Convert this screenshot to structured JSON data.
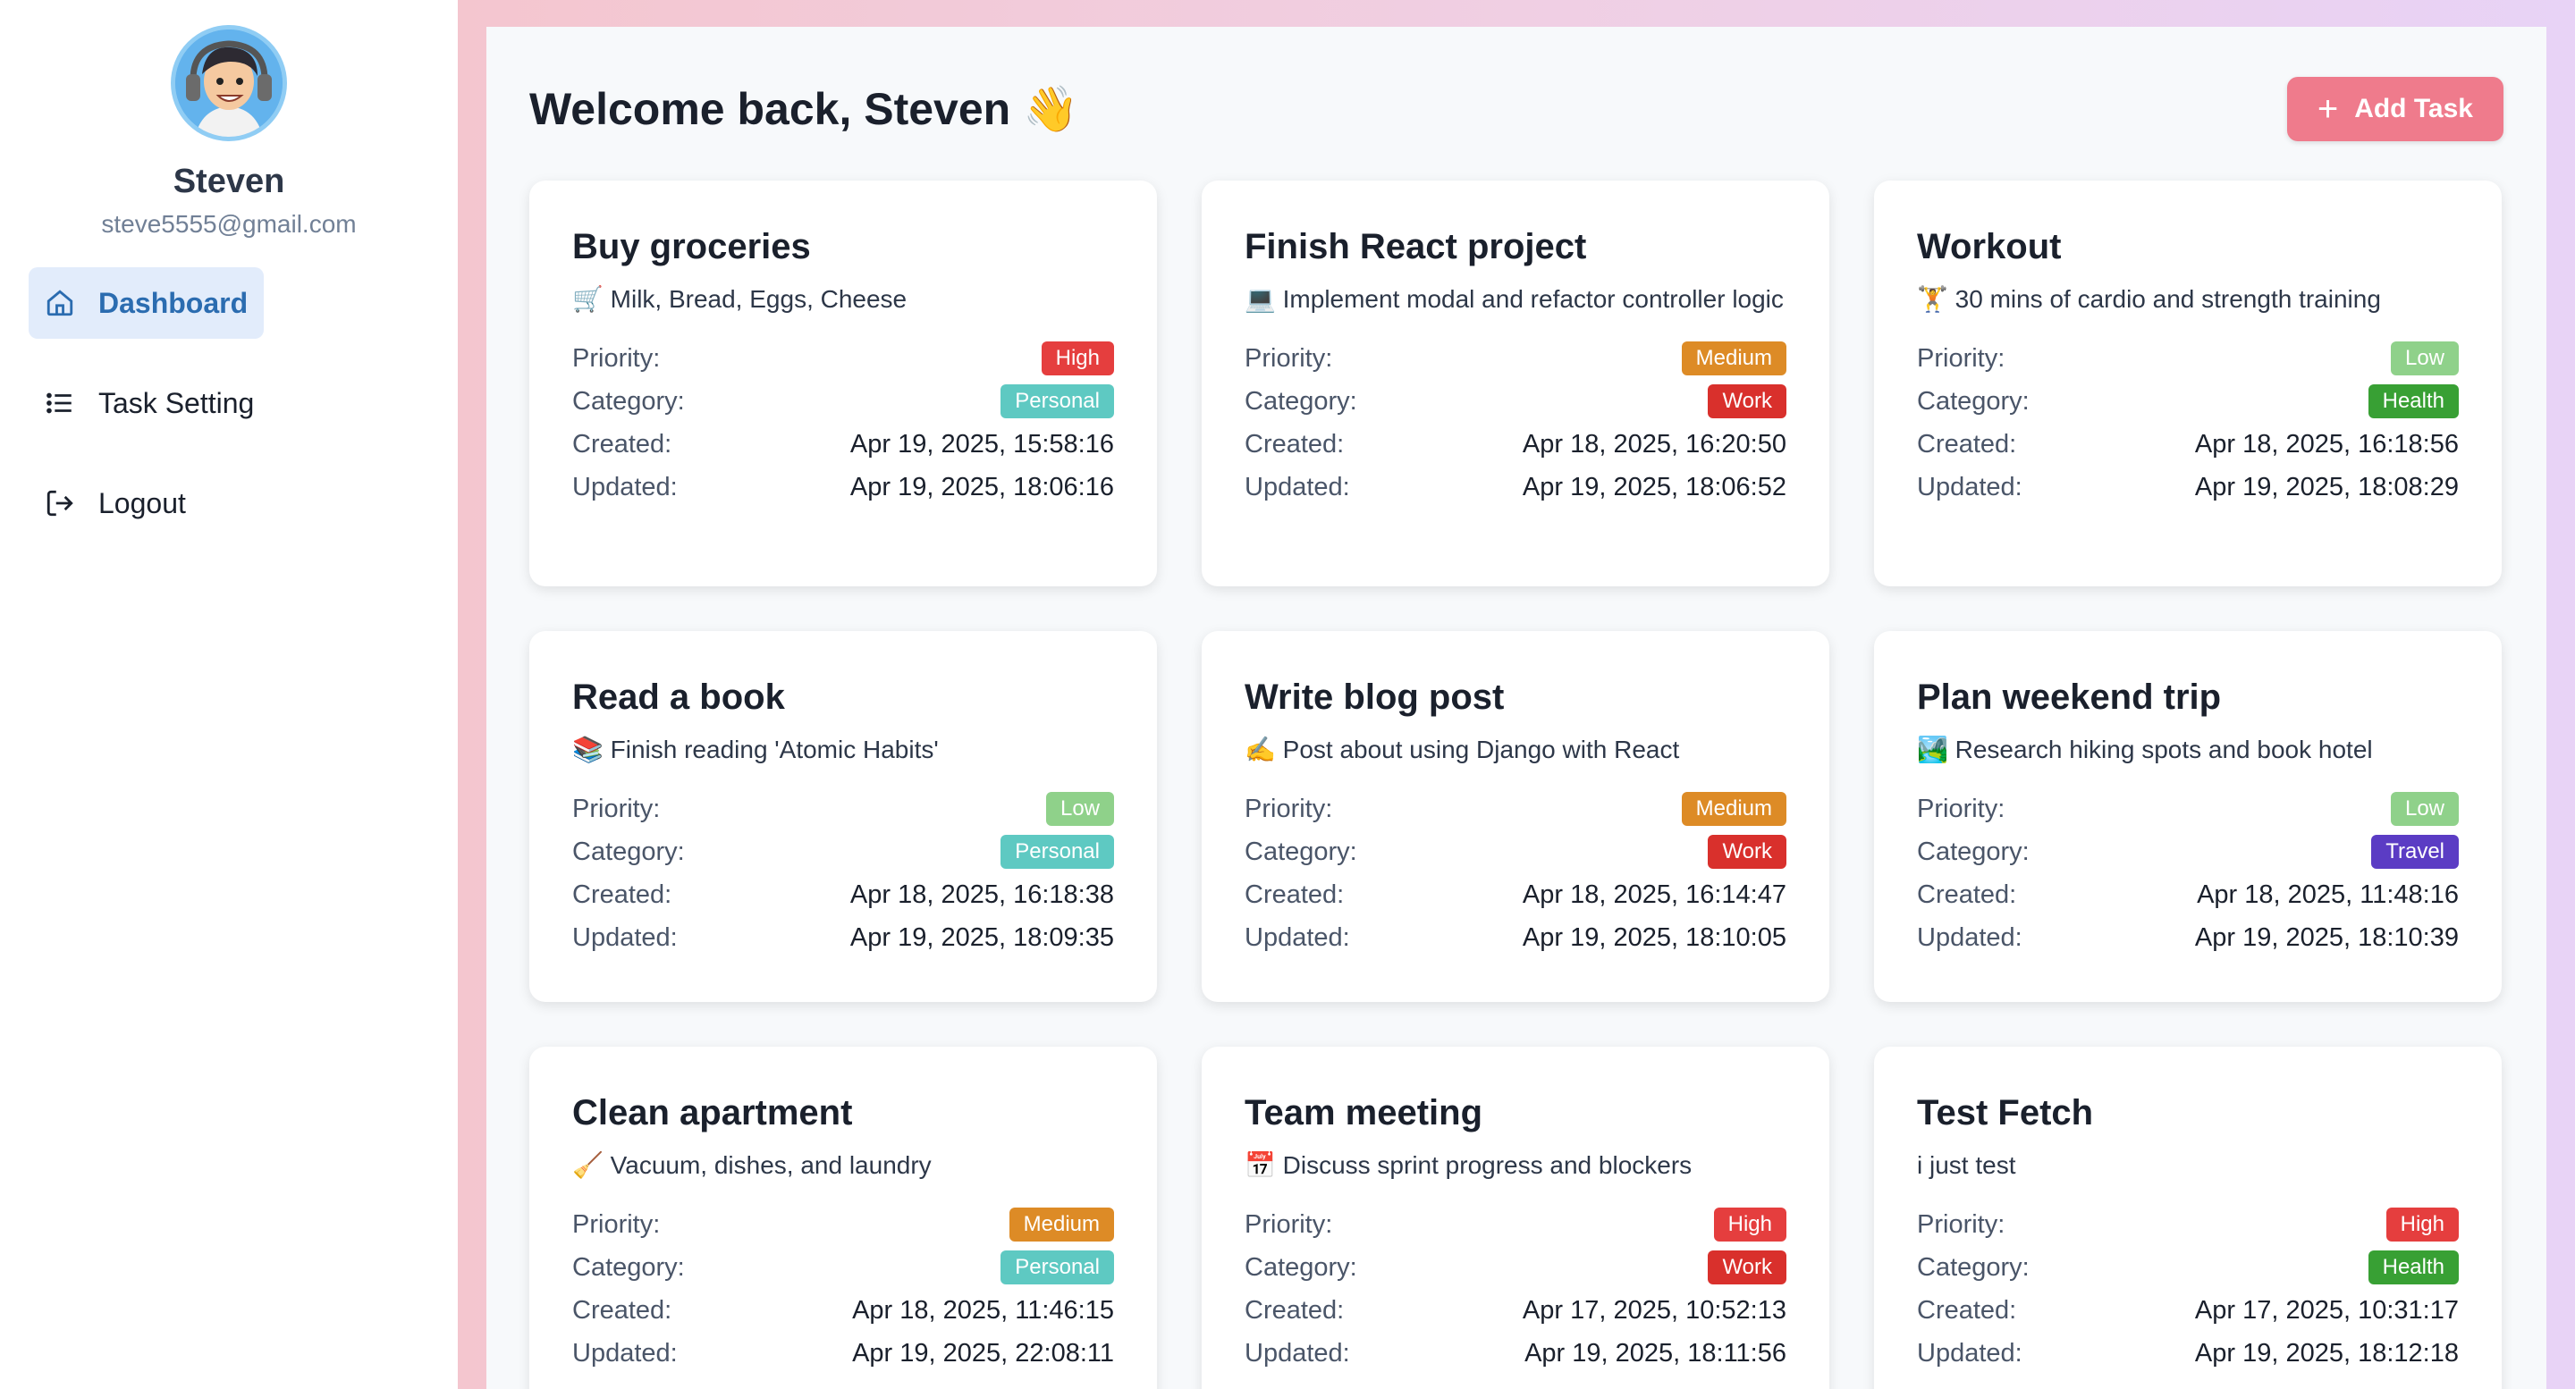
{
  "user": {
    "name": "Steven",
    "email": "steve5555@gmail.com"
  },
  "nav": [
    {
      "label": "Dashboard",
      "icon": "home-icon",
      "active": true
    },
    {
      "label": "Task Setting",
      "icon": "list-icon",
      "active": false
    },
    {
      "label": "Logout",
      "icon": "logout-icon",
      "active": false
    }
  ],
  "header": {
    "title": "Welcome back, Steven 👋",
    "add_label": "Add Task"
  },
  "labels": {
    "priority": "Priority:",
    "category": "Category:",
    "created": "Created:",
    "updated": "Updated:"
  },
  "colors": {
    "High": "#e53e3e",
    "Medium": "#dd8b26",
    "Low": "#8fd18a",
    "Personal": "#5ec9c2",
    "Work": "#d9302c",
    "Health": "#38a034",
    "Travel": "#5b3cc4",
    "accent": "#2b6cb0",
    "button": "#ef7b8c"
  },
  "tasks": [
    {
      "title": "Buy groceries",
      "desc": "🛒 Milk, Bread, Eggs, Cheese",
      "priority": "High",
      "category": "Personal",
      "created": "Apr 19, 2025, 15:58:16",
      "updated": "Apr 19, 2025, 18:06:16"
    },
    {
      "title": "Finish React project",
      "desc": "💻 Implement modal and refactor controller logic",
      "priority": "Medium",
      "category": "Work",
      "created": "Apr 18, 2025, 16:20:50",
      "updated": "Apr 19, 2025, 18:06:52"
    },
    {
      "title": "Workout",
      "desc": "🏋️ 30 mins of cardio and strength training",
      "priority": "Low",
      "category": "Health",
      "created": "Apr 18, 2025, 16:18:56",
      "updated": "Apr 19, 2025, 18:08:29"
    },
    {
      "title": "Read a book",
      "desc": "📚 Finish reading 'Atomic Habits'",
      "priority": "Low",
      "category": "Personal",
      "created": "Apr 18, 2025, 16:18:38",
      "updated": "Apr 19, 2025, 18:09:35"
    },
    {
      "title": "Write blog post",
      "desc": "✍️ Post about using Django with React",
      "priority": "Medium",
      "category": "Work",
      "created": "Apr 18, 2025, 16:14:47",
      "updated": "Apr 19, 2025, 18:10:05"
    },
    {
      "title": "Plan weekend trip",
      "desc": "🏞️ Research hiking spots and book hotel",
      "priority": "Low",
      "category": "Travel",
      "created": "Apr 18, 2025, 11:48:16",
      "updated": "Apr 19, 2025, 18:10:39"
    },
    {
      "title": "Clean apartment",
      "desc": "🧹 Vacuum, dishes, and laundry",
      "priority": "Medium",
      "category": "Personal",
      "created": "Apr 18, 2025, 11:46:15",
      "updated": "Apr 19, 2025, 22:08:11"
    },
    {
      "title": "Team meeting",
      "desc": "📅 Discuss sprint progress and blockers",
      "priority": "High",
      "category": "Work",
      "created": "Apr 17, 2025, 10:52:13",
      "updated": "Apr 19, 2025, 18:11:56"
    },
    {
      "title": "Test Fetch",
      "desc": "i just test",
      "priority": "High",
      "category": "Health",
      "created": "Apr 17, 2025, 10:31:17",
      "updated": "Apr 19, 2025, 18:12:18"
    }
  ]
}
